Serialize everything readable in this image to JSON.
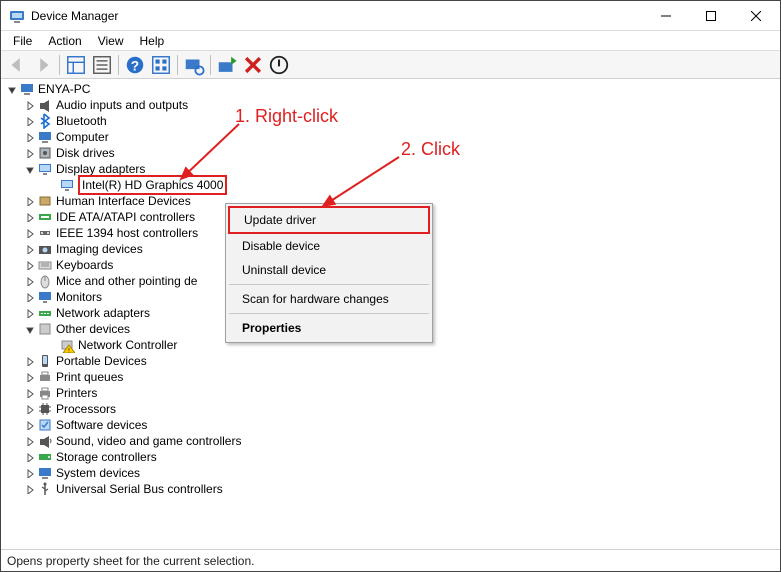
{
  "window": {
    "title": "Device Manager"
  },
  "menu": {
    "file": "File",
    "action": "Action",
    "view": "View",
    "help": "Help"
  },
  "tree": {
    "root": "ENYA-PC",
    "items": [
      {
        "label": "Audio inputs and outputs",
        "icon": "audio"
      },
      {
        "label": "Bluetooth",
        "icon": "bluetooth"
      },
      {
        "label": "Computer",
        "icon": "computer"
      },
      {
        "label": "Disk drives",
        "icon": "disk"
      },
      {
        "label": "Display adapters",
        "icon": "display",
        "expanded": true,
        "children": [
          {
            "label": "Intel(R) HD Graphics 4000",
            "icon": "display",
            "selected": true
          }
        ]
      },
      {
        "label": "Human Interface Devices",
        "icon": "hid"
      },
      {
        "label": "IDE ATA/ATAPI controllers",
        "icon": "ide"
      },
      {
        "label": "IEEE 1394 host controllers",
        "icon": "ieee"
      },
      {
        "label": "Imaging devices",
        "icon": "imaging"
      },
      {
        "label": "Keyboards",
        "icon": "keyboard"
      },
      {
        "label": "Mice and other pointing de",
        "icon": "mouse"
      },
      {
        "label": "Monitors",
        "icon": "monitor"
      },
      {
        "label": "Network adapters",
        "icon": "network"
      },
      {
        "label": "Other devices",
        "icon": "other",
        "expanded": true,
        "children": [
          {
            "label": "Network Controller",
            "icon": "warn"
          }
        ]
      },
      {
        "label": "Portable Devices",
        "icon": "portable"
      },
      {
        "label": "Print queues",
        "icon": "printqueue"
      },
      {
        "label": "Printers",
        "icon": "printer"
      },
      {
        "label": "Processors",
        "icon": "cpu"
      },
      {
        "label": "Software devices",
        "icon": "software"
      },
      {
        "label": "Sound, video and game controllers",
        "icon": "sound"
      },
      {
        "label": "Storage controllers",
        "icon": "storage"
      },
      {
        "label": "System devices",
        "icon": "system"
      },
      {
        "label": "Universal Serial Bus controllers",
        "icon": "usb"
      }
    ]
  },
  "context_menu": {
    "update": "Update driver",
    "disable": "Disable device",
    "uninstall": "Uninstall device",
    "scan": "Scan for hardware changes",
    "properties": "Properties"
  },
  "annotations": {
    "step1": "1. Right-click",
    "step2": "2. Click"
  },
  "statusbar": "Opens property sheet for the current selection."
}
